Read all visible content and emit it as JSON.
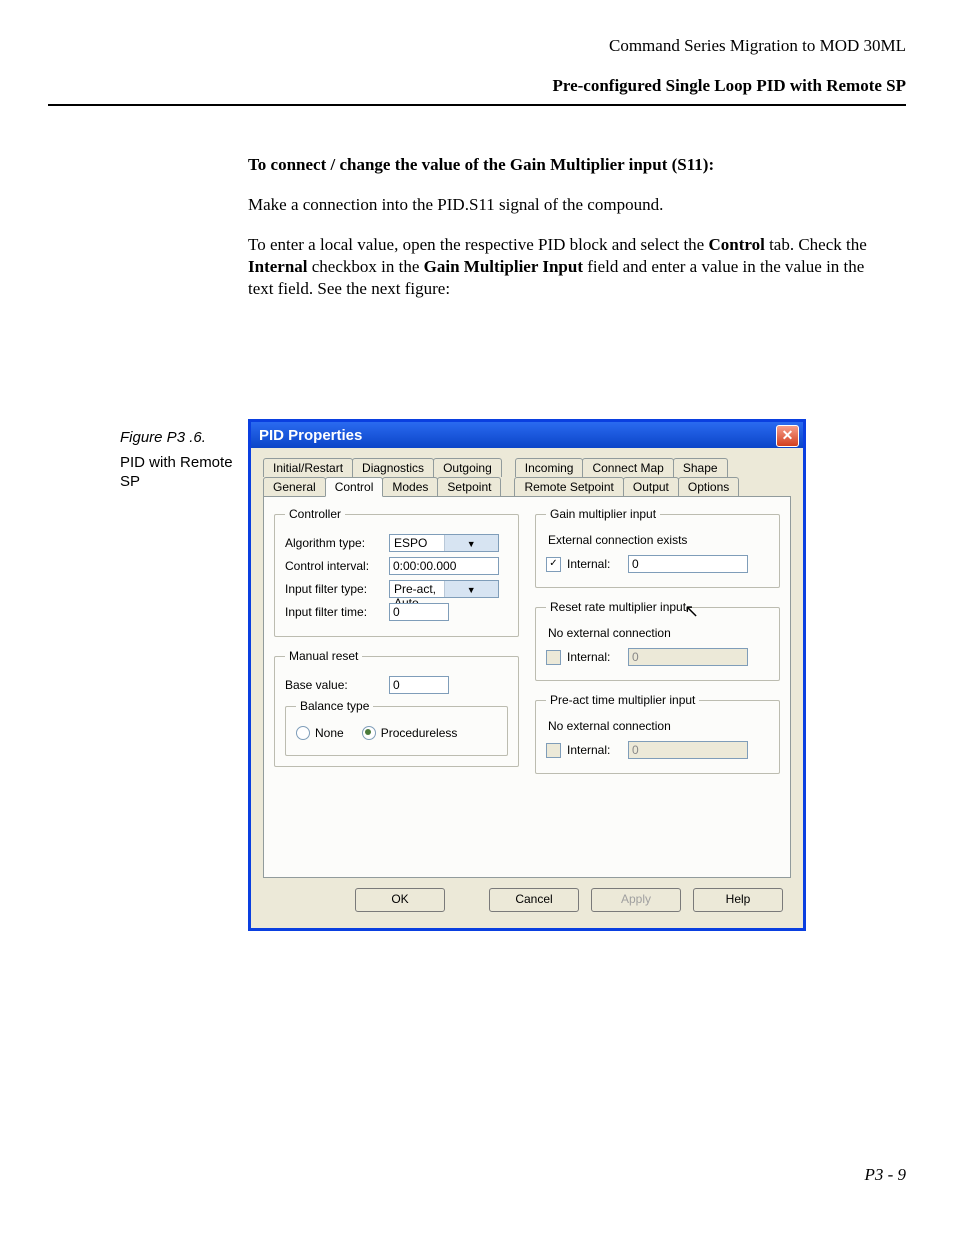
{
  "header": {
    "doc_title": "Command Series Migration to MOD 30ML",
    "section_title": "Pre-configured Single Loop PID with Remote SP"
  },
  "body": {
    "h1": "To connect / change the value of the Gain Multiplier input (S11):",
    "p1": "Make a connection into the PID.S11 signal of the compound.",
    "p2a": "To enter a local value, open the respective PID block and select the ",
    "p2b": " tab. Check the ",
    "p2c": " checkbox in the ",
    "p2d": " field and enter a value in the  value in the text field. See the next figure:",
    "bold_control": "Control",
    "bold_internal": "Internal",
    "bold_gmi": "Gain Multiplier Input"
  },
  "sidebar": {
    "figure_label": "Figure P3 .6.",
    "caption": "PID with Remote SP"
  },
  "dialog": {
    "title": "PID Properties",
    "close_glyph": "✕",
    "tabs_row1": [
      "Initial/Restart",
      "Diagnostics",
      "Outgoing",
      "Incoming",
      "Connect Map",
      "Shape"
    ],
    "tabs_row2": [
      "General",
      "Control",
      "Modes",
      "Setpoint",
      "Remote Setpoint",
      "Output",
      "Options"
    ],
    "active_tab": "Control",
    "controller": {
      "legend": "Controller",
      "algorithm_type_label": "Algorithm type:",
      "algorithm_type_value": "ESPO",
      "control_interval_label": "Control interval:",
      "control_interval_value": "0:00:00.000",
      "input_filter_type_label": "Input filter type:",
      "input_filter_type_value": "Pre-act, Auto",
      "input_filter_time_label": "Input filter time:",
      "input_filter_time_value": "0"
    },
    "manual_reset": {
      "legend": "Manual reset",
      "base_value_label": "Base value:",
      "base_value_value": "0",
      "balance_legend": "Balance type",
      "radio_none": "None",
      "radio_procedureless": "Procedureless"
    },
    "gain": {
      "legend": "Gain multiplier input",
      "note": "External connection exists",
      "internal_label": "Internal:",
      "internal_value": "0"
    },
    "reset_rate": {
      "legend": "Reset rate multiplier input",
      "note": "No external connection",
      "internal_label": "Internal:",
      "internal_value": "0"
    },
    "preact": {
      "legend": "Pre-act time multiplier input",
      "note": "No external connection",
      "internal_label": "Internal:",
      "internal_value": "0"
    },
    "buttons": {
      "ok": "OK",
      "cancel": "Cancel",
      "apply": "Apply",
      "help": "Help"
    }
  },
  "footer": {
    "page_number": "P3 - 9"
  }
}
